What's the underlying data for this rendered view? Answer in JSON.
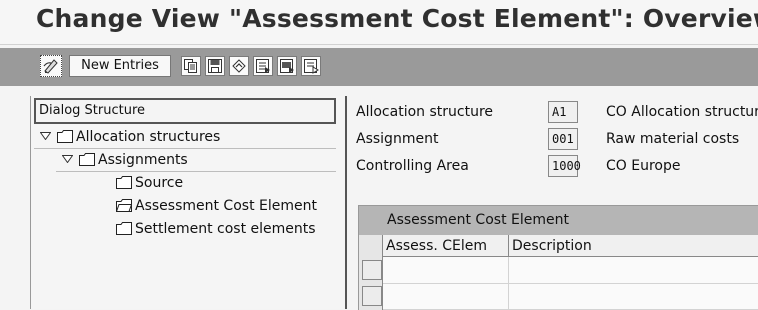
{
  "header": {
    "title": "Change View \"Assessment Cost Element\": Overview"
  },
  "toolbar": {
    "new_entries_label": "New Entries",
    "icons": [
      "display-change-icon",
      "copy-icon",
      "save-icon",
      "undo-icon",
      "select-all-icon",
      "select-block-icon",
      "deselect-all-icon"
    ]
  },
  "dialog_structure": {
    "header": "Dialog Structure",
    "items": [
      {
        "label": "Allocation structures",
        "level": 0,
        "expanded": true
      },
      {
        "label": "Assignments",
        "level": 1,
        "expanded": true
      },
      {
        "label": "Source",
        "level": 2,
        "open": false
      },
      {
        "label": "Assessment Cost Element",
        "level": 2,
        "open": true
      },
      {
        "label": "Settlement cost elements",
        "level": 2,
        "open": false
      }
    ]
  },
  "fields": [
    {
      "label": "Allocation structure",
      "value": "A1",
      "description": "CO Allocation structur"
    },
    {
      "label": "Assignment",
      "value": "001",
      "description": "Raw material costs"
    },
    {
      "label": "Controlling Area",
      "value": "1000",
      "description": "CO Europe"
    }
  ],
  "table": {
    "title": "Assessment Cost Element",
    "columns": [
      "Assess. CElem",
      "Description"
    ]
  }
}
